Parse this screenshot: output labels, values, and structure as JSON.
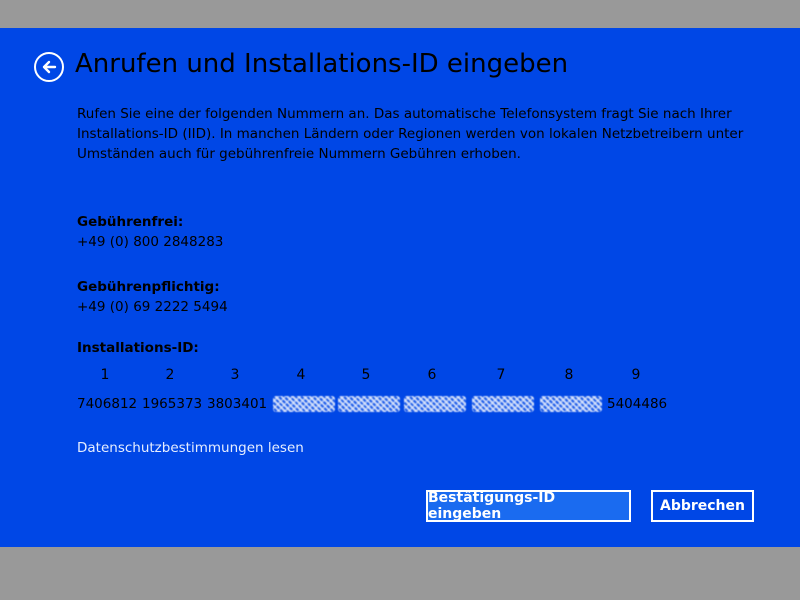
{
  "header": {
    "title": "Anrufen und Installations-ID eingeben"
  },
  "description": "Rufen Sie eine der folgenden Nummern an. Das automatische Telefonsystem fragt Sie nach Ihrer Installations-ID (IID). In manchen Ländern oder Regionen werden von lokalen Netzbetreibern unter Umständen auch für gebührenfreie Nummern Gebühren erhoben.",
  "toll_free": {
    "label": "Gebührenfrei:",
    "number": "+49 (0) 800 2848283"
  },
  "toll": {
    "label": "Gebührenpflichtig:",
    "number": "+49 (0) 69 2222 5494"
  },
  "installation_id": {
    "label": "Installations-ID:",
    "groups": [
      {
        "num": "1",
        "value": "7406812"
      },
      {
        "num": "2",
        "value": "1965373"
      },
      {
        "num": "3",
        "value": "3803401"
      },
      {
        "num": "4",
        "value": ""
      },
      {
        "num": "5",
        "value": ""
      },
      {
        "num": "6",
        "value": ""
      },
      {
        "num": "7",
        "value": ""
      },
      {
        "num": "8",
        "value": ""
      },
      {
        "num": "9",
        "value": "5404486"
      }
    ]
  },
  "privacy_link": "Datenschutzbestimmungen lesen",
  "buttons": {
    "primary": "Bestätigungs-ID eingeben",
    "cancel": "Abbrechen"
  },
  "colors": {
    "background": "#0047e6",
    "frame": "#999999",
    "primary_button": "#1a6bf0"
  },
  "icons": {
    "back": "back-arrow-icon"
  }
}
